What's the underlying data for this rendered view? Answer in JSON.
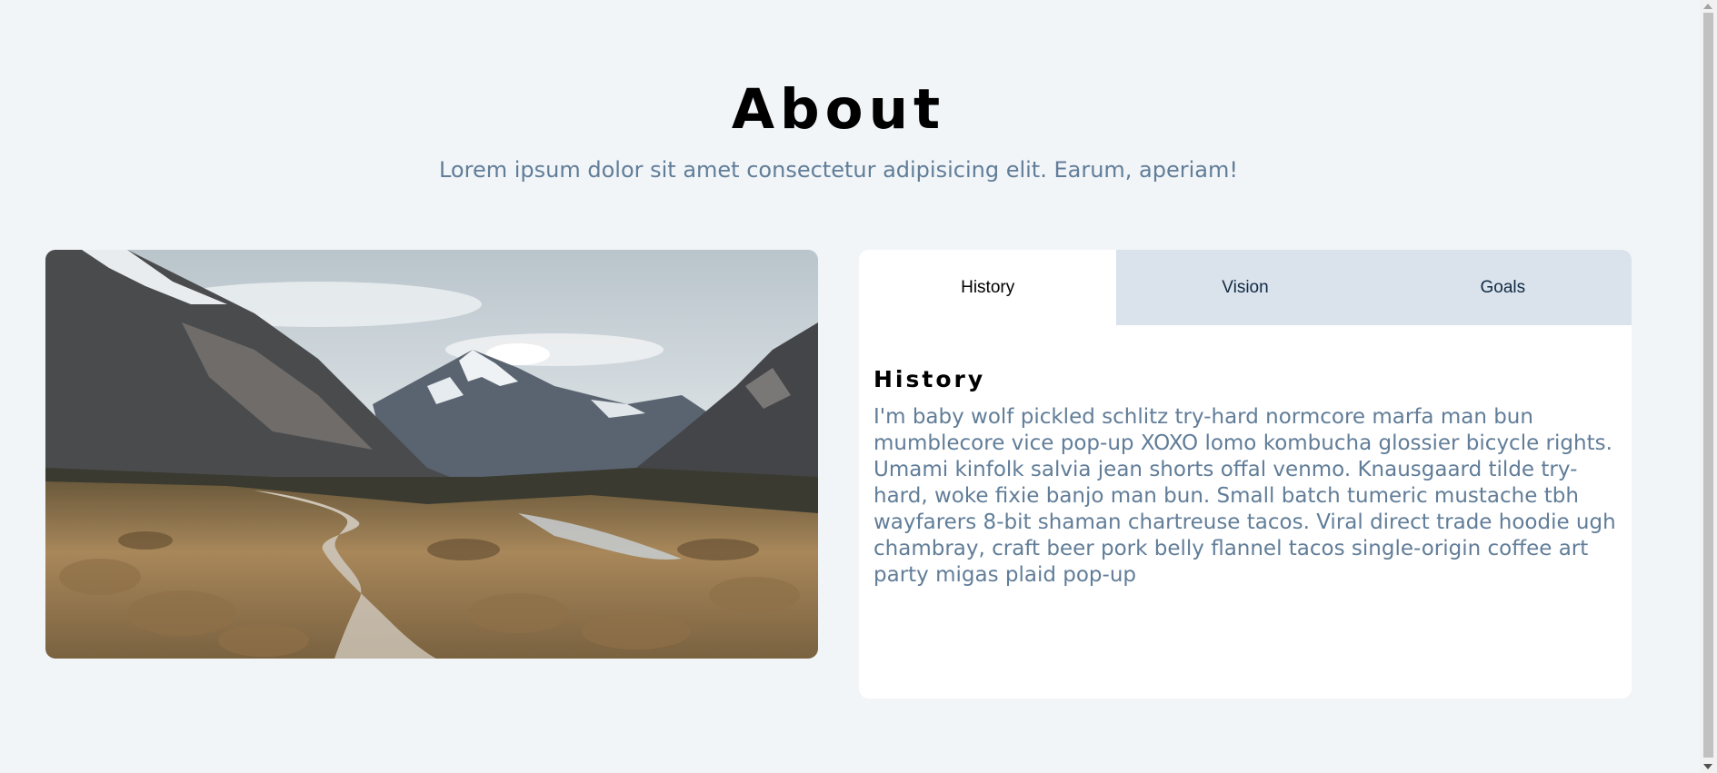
{
  "header": {
    "title": "About",
    "subtitle": "Lorem ipsum dolor sit amet consectetur adipisicing elit. Earum, aperiam!"
  },
  "image": {
    "alt": "mountain valley boardwalk",
    "sky_color": "#d7dee3",
    "grass_color": "#a8875a",
    "rock_color": "#56575a"
  },
  "tabs": {
    "items": [
      {
        "label": "History",
        "active": true
      },
      {
        "label": "Vision",
        "active": false
      },
      {
        "label": "Goals",
        "active": false
      }
    ]
  },
  "content": {
    "title": "History",
    "text": "I'm baby wolf pickled schlitz try-hard normcore marfa man bun mumblecore vice pop-up XOXO lomo kombucha glossier bicycle rights. Umami kinfolk salvia jean shorts offal venmo. Knausgaard tilde try-hard, woke fixie banjo man bun. Small batch tumeric mustache tbh wayfarers 8-bit shaman chartreuse tacos. Viral direct trade hoodie ugh chambray, craft beer pork belly flannel tacos single-origin coffee art party migas plaid pop-up"
  },
  "colors": {
    "background": "#f1f5f8",
    "title": "#000000",
    "body_text": "#617d98",
    "tab_inactive": "#dae2ec",
    "tab_active": "#ffffff"
  }
}
